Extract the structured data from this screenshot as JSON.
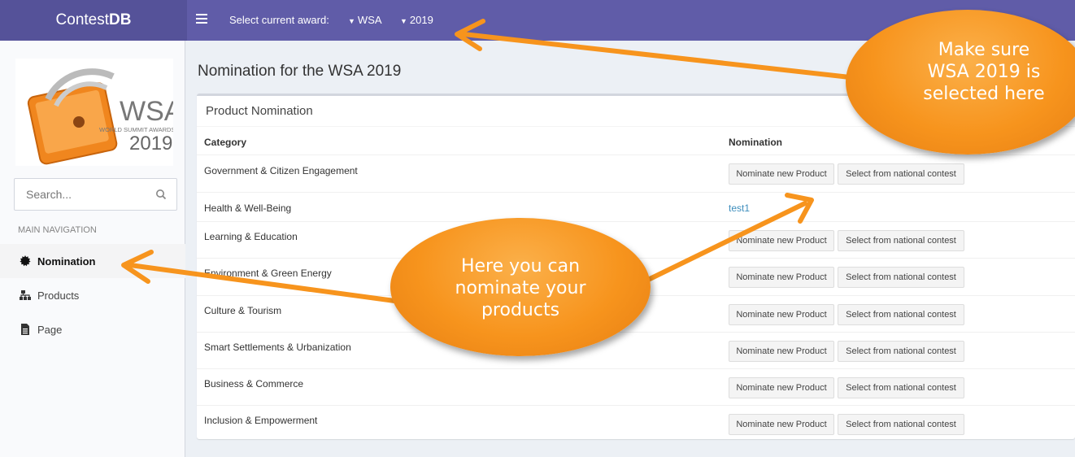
{
  "app": {
    "logo_light": "Contest",
    "logo_bold": "DB"
  },
  "topbar": {
    "award_label": "Select current award:",
    "award_value": "WSA",
    "year_value": "2019"
  },
  "sidebar": {
    "logo_alt": "WSA WORLD SUMMIT AWARDS 2019",
    "search_placeholder": "Search...",
    "nav_header": "MAIN NAVIGATION",
    "items": [
      {
        "label": "Nomination",
        "icon": "gear-icon",
        "active": true
      },
      {
        "label": "Products",
        "icon": "sitemap-icon",
        "active": false
      },
      {
        "label": "Page",
        "icon": "file-icon",
        "active": false
      }
    ]
  },
  "main": {
    "title": "Nomination for the WSA 2019",
    "box_title": "Product Nomination",
    "col_category": "Category",
    "col_nomination": "Nomination",
    "btn_nominate": "Nominate new Product",
    "btn_select": "Select from national contest",
    "rows": [
      {
        "category": "Government & Citizen Engagement",
        "nomination": null
      },
      {
        "category": "Health & Well-Being",
        "nomination": "test1"
      },
      {
        "category": "Learning & Education",
        "nomination": null
      },
      {
        "category": "Environment & Green Energy",
        "nomination": null
      },
      {
        "category": "Culture & Tourism",
        "nomination": null
      },
      {
        "category": "Smart Settlements & Urbanization",
        "nomination": null
      },
      {
        "category": "Business & Commerce",
        "nomination": null
      },
      {
        "category": "Inclusion & Empowerment",
        "nomination": null
      }
    ]
  },
  "callouts": {
    "top": [
      "Make sure",
      "WSA 2019 is",
      "selected here"
    ],
    "middle": [
      "Here you can",
      "nominate your",
      "products"
    ]
  },
  "colors": {
    "topbar": "#605ca8",
    "callout": "#f7941d",
    "link": "#3c8dbc"
  }
}
